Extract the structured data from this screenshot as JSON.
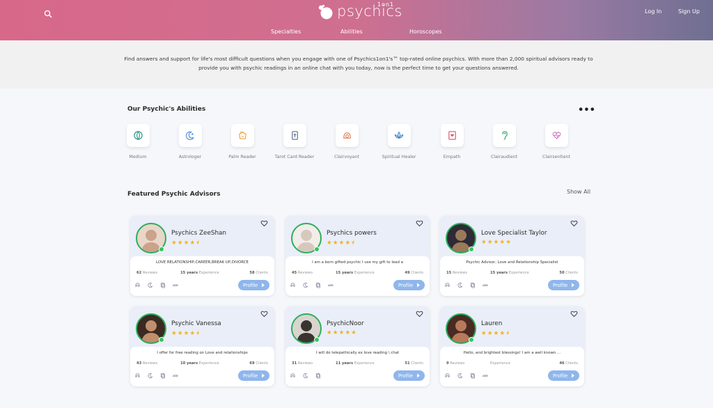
{
  "header": {
    "logo_text": "psychics",
    "logo_sup": "1on1",
    "login": "Log In",
    "signup": "Sign Up",
    "nav": [
      "Specialties",
      "Abilities",
      "Horoscopes"
    ]
  },
  "intro": {
    "text": "Find answers and support for life's most difficult questions when you engage with one of Psychics1on1's™ top-rated online psychics. With more than 2,000 spiritual advisors ready to provide you with psychic readings in an online chat with you today, now is the perfect time to get your questions answered."
  },
  "abilities": {
    "title": "Our Psychic's Abilities",
    "items": [
      {
        "label": "Medium",
        "icon": "medium-icon"
      },
      {
        "label": "Astrologer",
        "icon": "astrologer-icon"
      },
      {
        "label": "Palm Reader",
        "icon": "palm-icon"
      },
      {
        "label": "Tarot Card Reader",
        "icon": "tarot-icon"
      },
      {
        "label": "Clairvoyant",
        "icon": "clairvoyant-icon"
      },
      {
        "label": "Spiritual Healer",
        "icon": "lotus-icon"
      },
      {
        "label": "Empath",
        "icon": "empath-icon"
      },
      {
        "label": "Clairaudient",
        "icon": "ear-icon"
      },
      {
        "label": "Clairsentient",
        "icon": "heart-pulse-icon"
      }
    ]
  },
  "featured": {
    "title": "Featured Psychic Advisors",
    "show_all": "Show All",
    "reviews_label": "Reviews",
    "experience_label": "Experience",
    "clients_label": "Clients",
    "profile_label": "Profile",
    "advisors": [
      {
        "name": "Psychics ZeeShan",
        "rating": 4.5,
        "stars": "★★★★⯨",
        "bio": "LOVE RELATIONSHIP,CAREER,BREAK UP,DIVORCE",
        "reviews": "62",
        "years": "15 years",
        "clients": "58"
      },
      {
        "name": "Psychics powers",
        "rating": 4.5,
        "stars": "★★★★⯨",
        "bio": "I am a born gifted psychic I use my gift to lead a",
        "reviews": "45",
        "years": "15 years",
        "clients": "49"
      },
      {
        "name": "Love Specialist Taylor",
        "rating": 5,
        "stars": "★★★★★",
        "bio": "Psychic Advisor, Love and Relationship Specialist",
        "reviews": "15",
        "years": "15 years",
        "clients": "50"
      },
      {
        "name": "Psychic Vanessa",
        "rating": 4.5,
        "stars": "★★★★⯨",
        "bio": "I offer for free reading on Love and relationships",
        "reviews": "43",
        "years": "10 years",
        "clients": "69"
      },
      {
        "name": "PsychicNoor",
        "rating": 5,
        "stars": "★★★★★",
        "bio": "I will do telepathically ex love reading \\ chat",
        "reviews": "31",
        "years": "11 years",
        "clients": "51"
      },
      {
        "name": "Lauren",
        "rating": 4.5,
        "stars": "★★★★⯨",
        "bio": "Hello, and brightest blessings! I am a well known ...",
        "reviews": "9",
        "years": "",
        "clients": "46"
      }
    ]
  },
  "colors": {
    "accent": "#d8688a",
    "profile_button": "#8fb6ec",
    "online": "#34c45d",
    "star": "#f2b01e"
  }
}
